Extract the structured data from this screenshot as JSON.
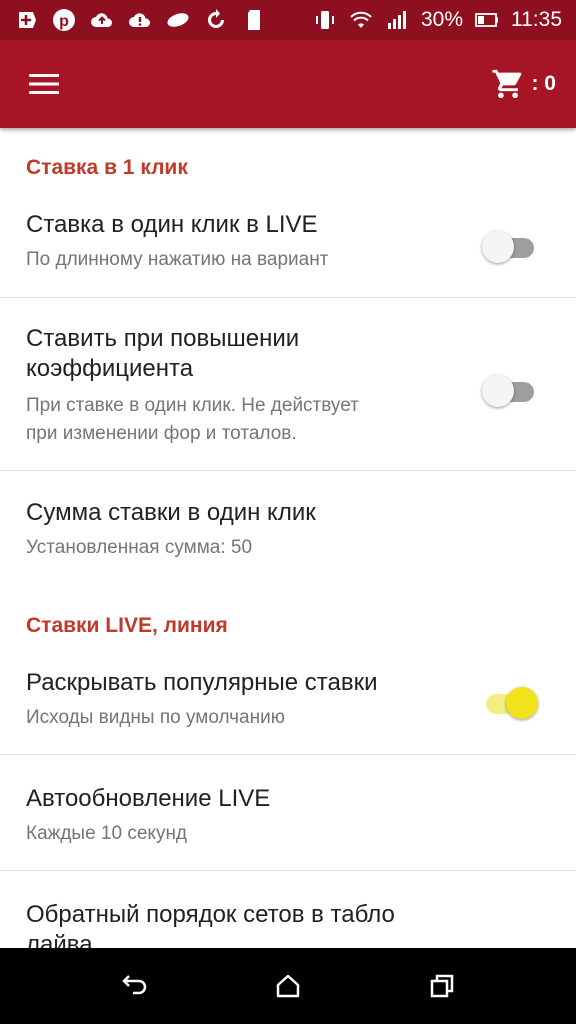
{
  "status_bar": {
    "battery": "30%",
    "time": "11:35",
    "left_icons": [
      "add-icon",
      "pinterest-icon",
      "cloud-upload-icon",
      "cloud-alert-icon",
      "toggle-icon",
      "sync-icon",
      "sd-card-icon"
    ],
    "right_icons": [
      "vibrate-icon",
      "wifi-icon",
      "signal-icon",
      "battery-icon"
    ]
  },
  "app_bar": {
    "cart_count": ": 0",
    "colors": {
      "primary": "#a71426",
      "status": "#8e1020"
    }
  },
  "sections": {
    "one_click": {
      "title": "Ставка в 1 клик",
      "items": [
        {
          "title": "Ставка в один клик в LIVE",
          "subtitle": "По длинному нажатию на вариант",
          "switch": "off"
        },
        {
          "title_line1": "Ставить при повышении",
          "title_line2": "коэффициента",
          "subtitle_line1": "При ставке в один клик. Не действует",
          "subtitle_line2": "при изменении фор и тоталов.",
          "switch": "off"
        },
        {
          "title": "Сумма ставки в один клик",
          "subtitle": "Установленная сумма: 50"
        }
      ]
    },
    "live": {
      "title": "Ставки LIVE, линия",
      "items": [
        {
          "title": "Раскрывать популярные ставки",
          "subtitle": "Исходы видны по умолчанию",
          "switch": "on"
        },
        {
          "title": "Автообновление LIVE",
          "subtitle": "Каждые 10 секунд"
        },
        {
          "title_line1": "Обратный порядок сетов в табло",
          "title_line2": "лайва"
        }
      ]
    }
  },
  "accent_color": "#c0392b",
  "switch_on_color": "#f2e21a"
}
